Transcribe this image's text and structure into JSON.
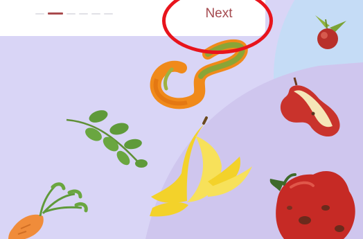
{
  "onboarding": {
    "next_label": "Next",
    "steps_total": 6,
    "active_step": 2
  },
  "colors": {
    "accent": "#a44a4f",
    "highlight_ring": "#e8141c",
    "background": "#d9d5f6",
    "circle_blue": "#c5dcf6"
  },
  "illustration": {
    "icons": [
      "tomato-icon",
      "orange-peel-icon",
      "apple-core-icon",
      "herb-sprig-icon",
      "banana-peel-icon",
      "carrot-icon",
      "rotten-pepper-icon"
    ]
  }
}
